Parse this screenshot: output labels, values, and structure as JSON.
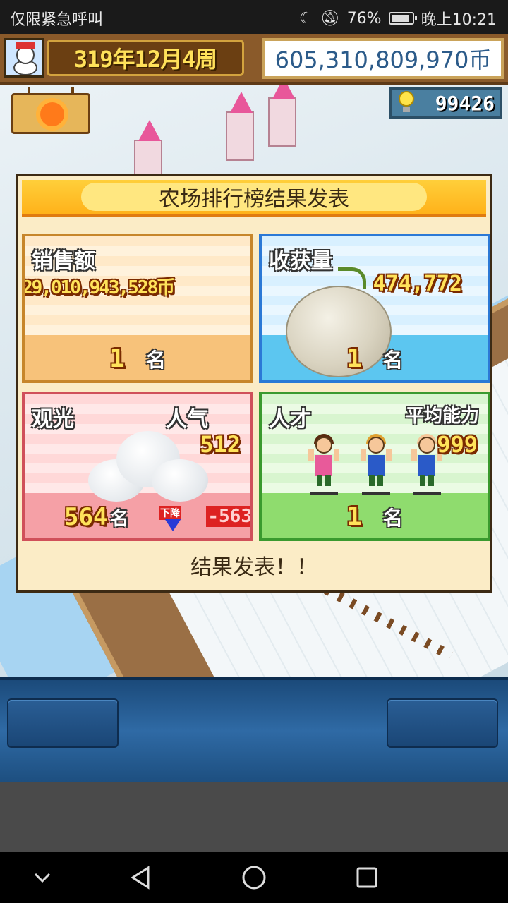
{
  "status_bar": {
    "carrier_text": "仅限紧急呼叫",
    "battery_percent": "76%",
    "time": "晚上10:21"
  },
  "hud": {
    "date": "319年12月4周",
    "money": "605,310,809,970币",
    "research_points": "99426"
  },
  "ranking_panel": {
    "title": "农场排行榜结果发表",
    "sales": {
      "label": "销售额",
      "value": "29,010,943,528币",
      "rank": "1",
      "rank_unit": "名"
    },
    "harvest": {
      "label": "收获量",
      "value": "474,772",
      "rank": "1",
      "rank_unit": "名"
    },
    "tourism": {
      "label": "观光",
      "sub_label": "人气",
      "value": "512",
      "rank": "564",
      "rank_unit": "名",
      "trend_label": "下降",
      "trend_value": "-563"
    },
    "talent": {
      "label": "人才",
      "sub_label": "平均能力",
      "value": "999",
      "rank": "1",
      "rank_unit": "名"
    },
    "footer": "结果发表！！"
  },
  "colors": {
    "hud_brown": "#8a5a2a",
    "panel_cream": "#fbecc6",
    "header_orange": "#ffb21a",
    "sales_border": "#c7862a",
    "harvest_border": "#2b79d6",
    "tourism_border": "#d0505a",
    "talent_border": "#3a9a2e",
    "controls_blue": "#2f6aa5"
  },
  "icons": {
    "avatar": "snowman-icon",
    "weather": "sun-icon",
    "research": "lightbulb-icon",
    "trend": "down-arrow-icon"
  }
}
